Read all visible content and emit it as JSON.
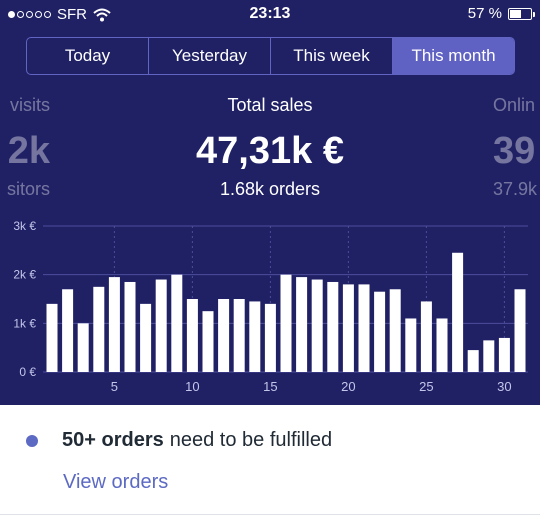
{
  "status_bar": {
    "carrier": "SFR",
    "time": "23:13",
    "battery": "57 %",
    "battery_level": 0.57,
    "signal_bars_filled": 1,
    "signal_bars_total": 5,
    "icons": [
      "signal-dots-icon",
      "wifi-icon",
      "battery-icon"
    ]
  },
  "period_tabs": [
    {
      "label": "Today",
      "active": false
    },
    {
      "label": "Yesterday",
      "active": false
    },
    {
      "label": "This week",
      "active": false
    },
    {
      "label": "This month",
      "active": true
    }
  ],
  "metrics": {
    "left": {
      "label": "visits",
      "value": "2k",
      "sub": "sitors"
    },
    "center": {
      "label": "Total sales",
      "value": "47,31k €",
      "sub": "1.68k orders"
    },
    "right": {
      "label": "Onlin",
      "value": "39",
      "sub": "37.9k"
    }
  },
  "chart_data": {
    "type": "bar",
    "x": [
      1,
      2,
      3,
      4,
      5,
      6,
      7,
      8,
      9,
      10,
      11,
      12,
      13,
      14,
      15,
      16,
      17,
      18,
      19,
      20,
      21,
      22,
      23,
      24,
      25,
      26,
      27,
      28,
      29,
      30,
      31
    ],
    "values": [
      1400,
      1700,
      1000,
      1750,
      1950,
      1850,
      1400,
      1900,
      2000,
      1500,
      1250,
      1500,
      1500,
      1450,
      1400,
      2000,
      1950,
      1900,
      1850,
      1800,
      1800,
      1650,
      1700,
      1100,
      1450,
      1100,
      2450,
      450,
      650,
      700,
      1700
    ],
    "ylim": [
      0,
      3000
    ],
    "y_ticks": [
      "0 €",
      "1k €",
      "2k €",
      "3k €"
    ],
    "x_ticks": [
      "5",
      "10",
      "15",
      "20",
      "25",
      "30"
    ],
    "grid": true,
    "colors": {
      "bar": "#ffffff",
      "grid": "#4b4d9c",
      "tick_text": "#c3c5ea"
    }
  },
  "notification": {
    "bold": "50+ orders",
    "text": "need to be fulfilled",
    "link": "View orders",
    "accent": "#5c6ac4"
  },
  "colors": {
    "header_bg": "#202165",
    "active_tab": "#5f62c3"
  }
}
